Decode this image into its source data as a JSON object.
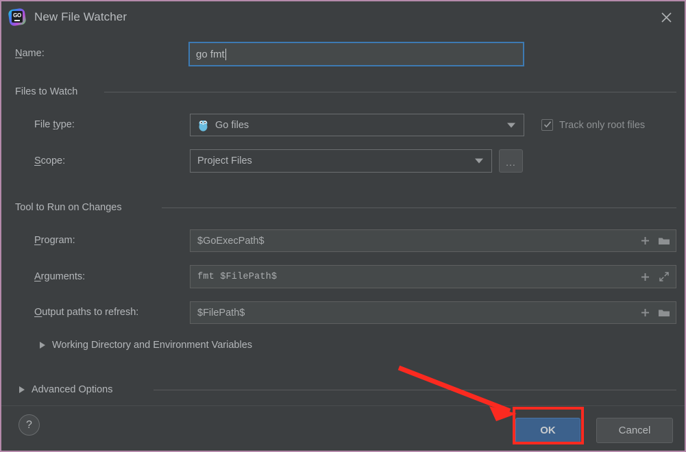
{
  "window": {
    "title": "New File Watcher",
    "app_icon": "goland-icon",
    "icon_text": "GO",
    "close_icon": "close-icon"
  },
  "name_row": {
    "label_prefix": "",
    "label_mnemonic": "N",
    "label_rest": "ame:",
    "value": "go fmt"
  },
  "files_to_watch": {
    "title": "Files to Watch",
    "file_type": {
      "label_pre": "File ",
      "label_mnemonic": "t",
      "label_post": "ype:",
      "value": "Go files",
      "icon": "go-gopher-icon",
      "arrow_icon": "chevron-down-icon"
    },
    "scope": {
      "label_mnemonic": "S",
      "label_post": "cope:",
      "value": "Project Files",
      "arrow_icon": "chevron-down-icon",
      "browse_label": "..."
    },
    "track_only_root": {
      "label": "Track only root files",
      "checked": true,
      "check_icon": "checkmark-icon"
    }
  },
  "tool_to_run": {
    "title": "Tool to Run on Changes",
    "program": {
      "label_mnemonic": "P",
      "label_post": "rogram:",
      "value": "$GoExecPath$",
      "add_icon": "plus-icon",
      "browse_icon": "folder-icon"
    },
    "arguments": {
      "label_mnemonic": "A",
      "label_post": "rguments:",
      "value": "fmt $FilePath$",
      "add_icon": "plus-icon",
      "expand_icon": "expand-arrows-icon"
    },
    "output_paths": {
      "label_mnemonic": "O",
      "label_post": "utput paths to refresh:",
      "value": "$FilePath$",
      "add_icon": "plus-icon",
      "browse_icon": "folder-icon"
    },
    "working_directory": {
      "label": "Working Directory and Environment Variables",
      "expanded": false,
      "triangle_icon": "triangle-right-icon"
    }
  },
  "advanced_options": {
    "label": "Advanced Options",
    "expanded": false,
    "triangle_icon": "triangle-right-icon"
  },
  "footer": {
    "help_label": "?",
    "help_icon": "question-mark-icon",
    "ok_label": "OK",
    "cancel_label": "Cancel"
  },
  "annotation": {
    "arrow_color": "#fb2a20",
    "box_color": "#fb2a20",
    "target": "ok-button"
  },
  "colors": {
    "dialog_bg": "#3c3f41",
    "field_bg": "#45494a",
    "focus_border": "#3d7ab3",
    "ok_button": "#3c618c",
    "window_border": "#b58aab",
    "text": "#b4b7ba"
  }
}
